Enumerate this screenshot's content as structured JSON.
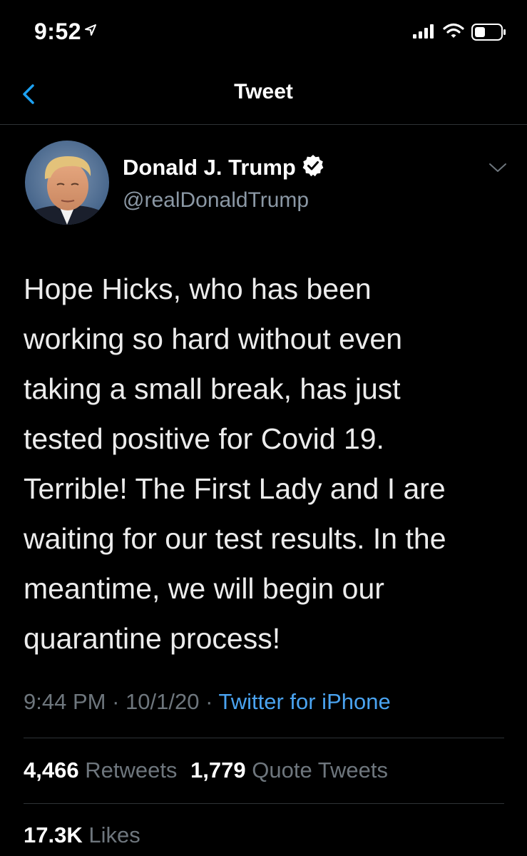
{
  "status_bar": {
    "time": "9:52",
    "icons": [
      "location-arrow-icon",
      "cellular-signal-icon",
      "wifi-icon",
      "battery-icon"
    ]
  },
  "nav": {
    "title": "Tweet",
    "back_icon": "chevron-left-icon"
  },
  "tweet": {
    "author": {
      "name": "Donald J. Trump",
      "handle": "@realDonaldTrump",
      "verified": true
    },
    "text": "Hope Hicks, who has been\nworking so hard without even\ntaking a small break, has just\ntested positive for Covid 19.\nTerrible! The First Lady and I are\nwaiting for our test results. In the\nmeantime, we will begin our\nquarantine process!",
    "time": "9:44 PM",
    "date": "10/1/20",
    "source": "Twitter for iPhone",
    "separator": "·",
    "stats": {
      "retweets_count": "4,466",
      "retweets_label": "Retweets",
      "quotes_count": "1,779",
      "quotes_label": "Quote Tweets",
      "likes_count": "17.3K",
      "likes_label": "Likes"
    }
  },
  "colors": {
    "background": "#000000",
    "accent_blue": "#1da1f2",
    "link_blue": "#4aa3f0",
    "muted_gray": "#6e767d",
    "divider": "#2f3336"
  }
}
